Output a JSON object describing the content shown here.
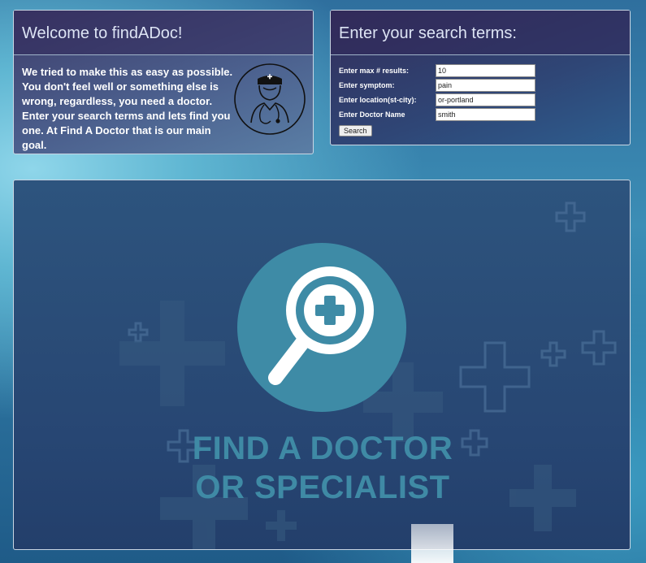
{
  "welcome": {
    "title": "Welcome to findADoc!",
    "text": "We tried to make this as easy as possible. You don't feel well or something else is wrong, regardless, you need a doctor. Enter your search terms and lets find you one. At Find A Doctor that is our main goal.",
    "icon": "doctor-icon"
  },
  "search": {
    "title": "Enter your search terms:",
    "fields": {
      "max_results": {
        "label": "Enter max # results:",
        "value": "10"
      },
      "symptom": {
        "label": "Enter symptom:",
        "value": "pain"
      },
      "location": {
        "label": "Enter location(st-city):",
        "value": "or-portland"
      },
      "doctor_name": {
        "label": "Enter Doctor Name",
        "value": "smith"
      }
    },
    "button_label": "Search"
  },
  "banner": {
    "line1": "FIND A DOCTOR",
    "line2": "OR SPECIALIST",
    "icon": "magnifier-medical-cross-icon",
    "colors": {
      "circle": "#3e8ba6",
      "text": "#3f8aa5"
    }
  }
}
